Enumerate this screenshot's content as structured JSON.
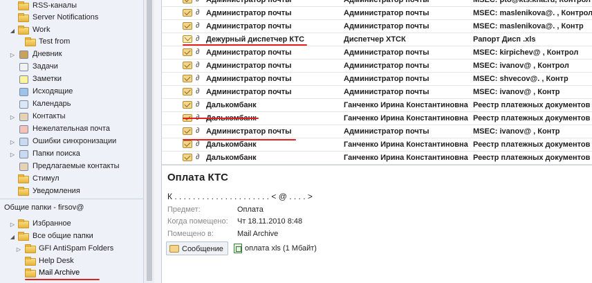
{
  "nav": {
    "items": [
      {
        "label": "RSS-каналы",
        "icon": "rss-folder-icon"
      },
      {
        "label": "Server Notifications",
        "icon": "folder-icon"
      },
      {
        "label": "Work",
        "icon": "folder-icon",
        "expander": "◢"
      },
      {
        "label": "Test from",
        "icon": "folder-icon"
      },
      {
        "label": "Дневник",
        "icon": "journal-icon",
        "expander": "▷"
      },
      {
        "label": "Задачи",
        "icon": "tasks-icon"
      },
      {
        "label": "Заметки",
        "icon": "notes-icon"
      },
      {
        "label": "Исходящие",
        "icon": "outbox-icon"
      },
      {
        "label": "Календарь",
        "icon": "calendar-icon"
      },
      {
        "label": "Контакты",
        "icon": "contacts-icon",
        "expander": "▷"
      },
      {
        "label": "Нежелательная почта",
        "icon": "junk-mail-icon"
      },
      {
        "label": "Ошибки синхронизации",
        "icon": "sync-issues-icon",
        "expander": "▷"
      },
      {
        "label": "Папки поиска",
        "icon": "search-folders-icon",
        "expander": "▷"
      },
      {
        "label": "Предлагаемые контакты",
        "icon": "suggested-contacts-icon"
      },
      {
        "label": "Стимул",
        "icon": "folder-icon"
      },
      {
        "label": "Уведомления",
        "icon": "folder-icon"
      }
    ],
    "public_header": "Общие папки - firsov@",
    "public_items": [
      {
        "label": "Избранное",
        "icon": "favorites-folder-icon",
        "expander": "▷"
      },
      {
        "label": "Все общие папки",
        "icon": "public-folders-icon",
        "expander": "◢"
      },
      {
        "label": "GFI AntiSpam Folders",
        "icon": "public-folder-icon",
        "expander": "▷"
      },
      {
        "label": "Help Desk",
        "icon": "public-folder-icon"
      },
      {
        "label": "Mail Archive",
        "icon": "public-folder-icon"
      }
    ]
  },
  "messages": [
    {
      "from": "Администратор почты",
      "to": "Администратор почты",
      "subject": "MSEC: pto@kts.kha.ru, Контрол",
      "icon": "read"
    },
    {
      "from": "Администратор почты",
      "to": "Администратор почты",
      "subject": "MSEC: maslenikova@. , Контрол",
      "icon": "read"
    },
    {
      "from": "Администратор почты",
      "to": "Администратор почты",
      "subject": "MSEC: maslenikova@. , Контр",
      "icon": "read"
    },
    {
      "from": "Дежурный диспетчер КТС",
      "to": "Диспетчер ХТСК",
      "subject": "Рапорт Дисп .xls",
      "icon": "unread"
    },
    {
      "from": "Администратор почты",
      "to": "Администратор почты",
      "subject": "MSEC: kirpichev@ , Контрол",
      "icon": "read"
    },
    {
      "from": "Администратор почты",
      "to": "Администратор почты",
      "subject": "MSEC: ivanov@ , Контрол",
      "icon": "read"
    },
    {
      "from": "Администратор почты",
      "to": "Администратор почты",
      "subject": "MSEC: shvecov@. , Контр",
      "icon": "read"
    },
    {
      "from": "Администратор почты",
      "to": "Администратор почты",
      "subject": "MSEC: ivanov@ , Контр",
      "icon": "read"
    },
    {
      "from": "Далькомбанк",
      "to": "Ганченко Ирина Константиновна",
      "subject": "Реестр платежных документов",
      "icon": "read"
    },
    {
      "from": "Далькомбанк",
      "to": "Ганченко Ирина Константиновна",
      "subject": "Реестр платежных документов",
      "icon": "read"
    },
    {
      "from": "Администратор почты",
      "to": "Администратор почты",
      "subject": "MSEC: ivanov@ , Контр",
      "icon": "read"
    },
    {
      "from": "Далькомбанк",
      "to": "Ганченко Ирина Константиновна",
      "subject": "Реестр платежных документов",
      "icon": "read"
    },
    {
      "from": "Далькомбанк",
      "to": "Ганченко Ирина Константиновна",
      "subject": "Реестр платежных документов",
      "icon": "read"
    }
  ],
  "reading": {
    "title": "Оплата КТС",
    "sender": "К . . . . . . . . . . . . . . . . . . . . . < @ . . . . >",
    "subject_label": "Предмет:",
    "subject_value": "Оплата",
    "posted_label": "Когда помещено:",
    "posted_value": "Чт 18.11.2010 8:48",
    "folder_label": "Помещено в:",
    "folder_value": "Mail Archive",
    "tab_message": "Сообщение",
    "attachment": "оплата xls (1 Мбайт)"
  },
  "colors": {
    "nav_bg": "#eef2f8",
    "annotation_red": "#e02020"
  }
}
